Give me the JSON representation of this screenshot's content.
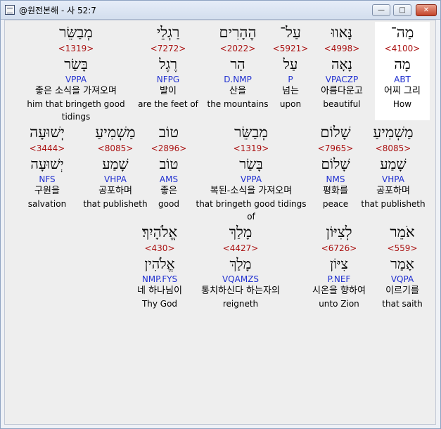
{
  "window": {
    "title": "@원전본해 - 사 52:7",
    "minimize_glyph": "—",
    "maximize_glyph": "□",
    "close_glyph": "✕"
  },
  "rows": [
    [
      {
        "heb": "מְבַשֵּׂר",
        "num": "<1319>",
        "lemma": "בָּשַׂר",
        "code": "VPPA",
        "kor": "좋은 소식을 가져오며",
        "eng": "him that bringeth good tidings"
      },
      {
        "heb": "רַגְלֵי",
        "num": "<7272>",
        "lemma": "רֶגֶל",
        "code": "NFPG",
        "kor": "발이",
        "eng": "are the feet of"
      },
      {
        "heb": "הֶהָרִים",
        "num": "<2022>",
        "lemma": "הַר",
        "code": "D.NMP",
        "kor": "산을",
        "eng": "the mountains"
      },
      {
        "heb": "עַל־",
        "num": "<5921>",
        "lemma": "עַל",
        "code": "P",
        "kor": "넘는",
        "eng": "upon"
      },
      {
        "heb": "נָּאווּ",
        "num": "<4998>",
        "lemma": "נָאָה",
        "code": "VPACZP",
        "kor": "아름다운고",
        "eng": "beautiful"
      },
      {
        "heb": "מַה־",
        "num": "<4100>",
        "lemma": "מָה",
        "code": "ABT",
        "kor": "어찌 그리",
        "eng": "How"
      }
    ],
    [
      {
        "heb": "יְשׁוּעָה",
        "num": "<3444>",
        "lemma": "יְשׁוּעָה",
        "code": "NFS",
        "kor": "구원을",
        "eng": "salvation"
      },
      {
        "heb": "מַשְׁמִיעַ",
        "num": "<8085>",
        "lemma": "שָׁמַע",
        "code": "VHPA",
        "kor": "공포하며",
        "eng": "that publisheth"
      },
      {
        "heb": "טוֹב",
        "num": "<2896>",
        "lemma": "טוֹב",
        "code": "AMS",
        "kor": "좋은",
        "eng": "good"
      },
      {
        "heb": "מְבַשֵּׂר",
        "num": "<1319>",
        "lemma": "בָּשַׂר",
        "code": "VPPA",
        "kor": "복된-소식을 가져오며",
        "eng": "that bringeth good tidings of"
      },
      {
        "heb": "שָׁלוֹם",
        "num": "<7965>",
        "lemma": "שָׁלוֹם",
        "code": "NMS",
        "kor": "평화를",
        "eng": "peace"
      },
      {
        "heb": "מַשְׁמִיעַ",
        "num": "<8085>",
        "lemma": "שָׁמַע",
        "code": "VHPA",
        "kor": "공포하며",
        "eng": "that publisheth"
      }
    ],
    [
      {
        "heb": "אֱלֹהָיִךְ׃",
        "num": "<430>",
        "lemma": "אֱלֹהִין",
        "code": "NMP.FYS",
        "kor": "네 하나님이",
        "eng": "Thy God"
      },
      {
        "heb": "מָלַךְ",
        "num": "<4427>",
        "lemma": "מָלַךְ",
        "code": "VQAMZS",
        "kor": "통치하신다 하는자의",
        "eng": "reigneth"
      },
      {
        "heb": "לְצִיּוֹן",
        "num": "<6726>",
        "lemma": "צִיּוֹן",
        "code": "P.NEF",
        "kor": "시온을 향하여",
        "eng": "unto Zion"
      },
      {
        "heb": "אֹמֵר",
        "num": "<559>",
        "lemma": "אָמַר",
        "code": "VQPA",
        "kor": "이르기를",
        "eng": "that saith"
      }
    ]
  ]
}
